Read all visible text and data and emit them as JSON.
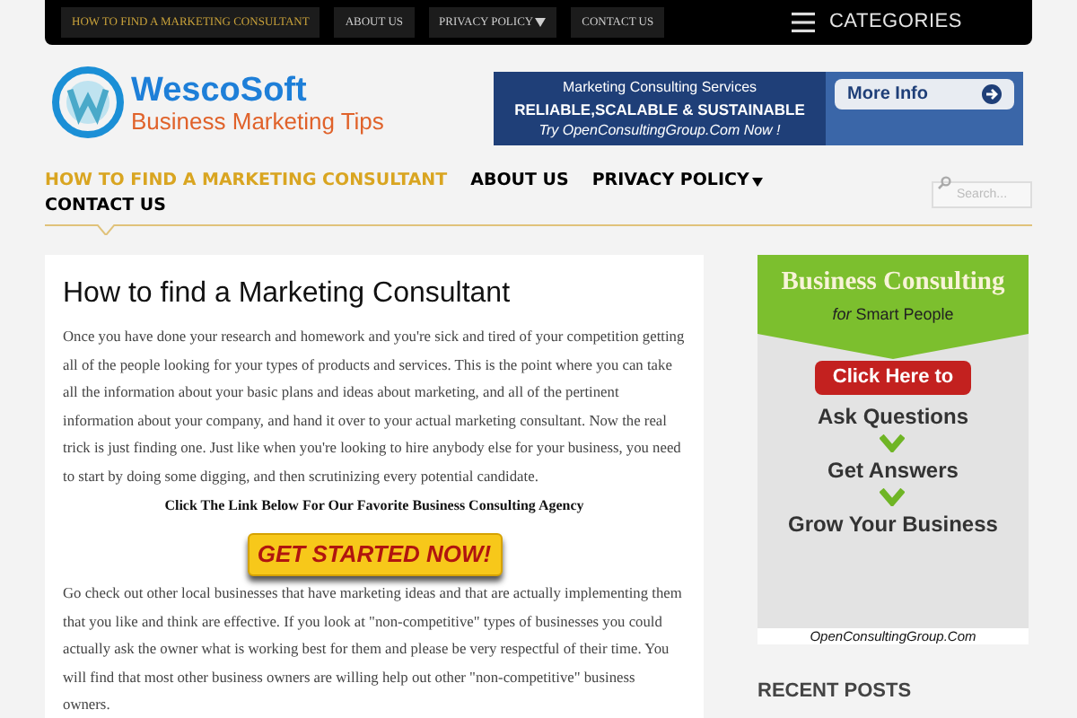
{
  "top_nav": [
    {
      "label": "HOW TO FIND A MARKETING CONSULTANT",
      "selected": true
    },
    {
      "label": "ABOUT US",
      "selected": false
    },
    {
      "label": "PRIVACY POLICY",
      "selected": false,
      "dropdown": true
    },
    {
      "label": "CONTACT US",
      "selected": false
    }
  ],
  "categories": {
    "label": "CATEGORIES"
  },
  "logo": {
    "name": "WescoSoft",
    "tagline": "Business Marketing Tips"
  },
  "banner": {
    "line_1": "Marketing Consulting Services",
    "line_2": "RELIABLE,SCALABLE & SUSTAINABLE",
    "line_3": "Try OpenConsultingGroup.Com Now !",
    "button": "More Info"
  },
  "main_nav": [
    {
      "label": "HOW TO FIND A MARKETING CONSULTANT",
      "selected": true
    },
    {
      "label": "ABOUT US",
      "selected": false
    },
    {
      "label": "PRIVACY POLICY",
      "selected": false,
      "dropdown": true
    },
    {
      "label": "CONTACT US",
      "selected": false
    }
  ],
  "search": {
    "placeholder": "Search..."
  },
  "article": {
    "title": "How to find a Marketing Consultant",
    "paragraph_1": "Once you have done your research and homework and you're sick and tired of your competition getting all of the people looking for your types of products and services. This is the point where you can take all the information about your basic plans and ideas about marketing, and all of the pertinent information about your company, and hand it over to your actual marketing consultant. Now the real trick is just finding one. Just like when you're looking to hire anybody else for your business, you need to start by doing some digging, and then scrutinizing every potential candidate.",
    "cta_caption": "Click The Link Below For Our Favorite Business Consulting Agency",
    "cta_button": "GET STARTED NOW!",
    "paragraph_2": "Go check out other local businesses that have marketing ideas and that are actually implementing them that you like and think are effective. If you look at \"non-competitive\" types of businesses you could actually ask the owner what is working best for them and please be very respectful of their time. You will find that most other business owners are willing help out other \"non-competitive\" business owners."
  },
  "sidebar_ad": {
    "title": "Business Consulting",
    "subtitle_prefix": "for",
    "subtitle": "Smart People",
    "button": "Click Here to",
    "steps": [
      "Ask Questions",
      "Get Answers",
      "Grow Your Business"
    ],
    "url": "OpenConsultingGroup.Com"
  },
  "recent_posts": {
    "heading": "RECENT POSTS"
  }
}
